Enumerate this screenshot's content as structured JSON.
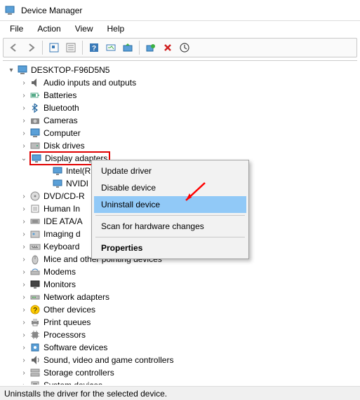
{
  "window": {
    "title": "Device Manager"
  },
  "menu": {
    "file": "File",
    "action": "Action",
    "view": "View",
    "help": "Help"
  },
  "toolbar_icons": {
    "back": "back-icon",
    "forward": "forward-icon",
    "show_hidden": "show-hidden-icon",
    "properties": "properties-icon",
    "help": "help-icon",
    "scan_inline": "scan-inline-icon",
    "update_driver": "update-driver-icon",
    "scan_hardware": "scan-hardware-icon",
    "uninstall": "uninstall-icon",
    "add_legacy": "add-legacy-icon"
  },
  "tree": {
    "root": "DESKTOP-F96D5N5",
    "items": [
      {
        "label": "Audio inputs and outputs",
        "icon": "audio"
      },
      {
        "label": "Batteries",
        "icon": "battery"
      },
      {
        "label": "Bluetooth",
        "icon": "bluetooth"
      },
      {
        "label": "Cameras",
        "icon": "camera"
      },
      {
        "label": "Computer",
        "icon": "computer"
      },
      {
        "label": "Disk drives",
        "icon": "disk"
      },
      {
        "label": "Display adapters",
        "icon": "display",
        "expanded": true,
        "highlight": true,
        "children": [
          {
            "label": "Intel(R",
            "icon": "display"
          },
          {
            "label": "NVIDI",
            "icon": "display"
          }
        ]
      },
      {
        "label": "DVD/CD-R",
        "icon": "dvd"
      },
      {
        "label": "Human In",
        "icon": "hid"
      },
      {
        "label": "IDE ATA/A",
        "icon": "ide"
      },
      {
        "label": "Imaging d",
        "icon": "imaging"
      },
      {
        "label": "Keyboard",
        "icon": "keyboard"
      },
      {
        "label": "Mice and other pointing devices",
        "icon": "mouse"
      },
      {
        "label": "Modems",
        "icon": "modem"
      },
      {
        "label": "Monitors",
        "icon": "monitor"
      },
      {
        "label": "Network adapters",
        "icon": "network"
      },
      {
        "label": "Other devices",
        "icon": "other"
      },
      {
        "label": "Print queues",
        "icon": "printer"
      },
      {
        "label": "Processors",
        "icon": "processor"
      },
      {
        "label": "Software devices",
        "icon": "software"
      },
      {
        "label": "Sound, video and game controllers",
        "icon": "sound"
      },
      {
        "label": "Storage controllers",
        "icon": "storage"
      },
      {
        "label": "System devices",
        "icon": "system"
      }
    ]
  },
  "context_menu": {
    "update": "Update driver",
    "disable": "Disable device",
    "uninstall": "Uninstall device",
    "scan": "Scan for hardware changes",
    "properties": "Properties"
  },
  "statusbar": {
    "text": "Uninstalls the driver for the selected device."
  },
  "colors": {
    "highlight": "#91c9f7",
    "red_box": "#e00000",
    "arrow": "#ff0000"
  }
}
